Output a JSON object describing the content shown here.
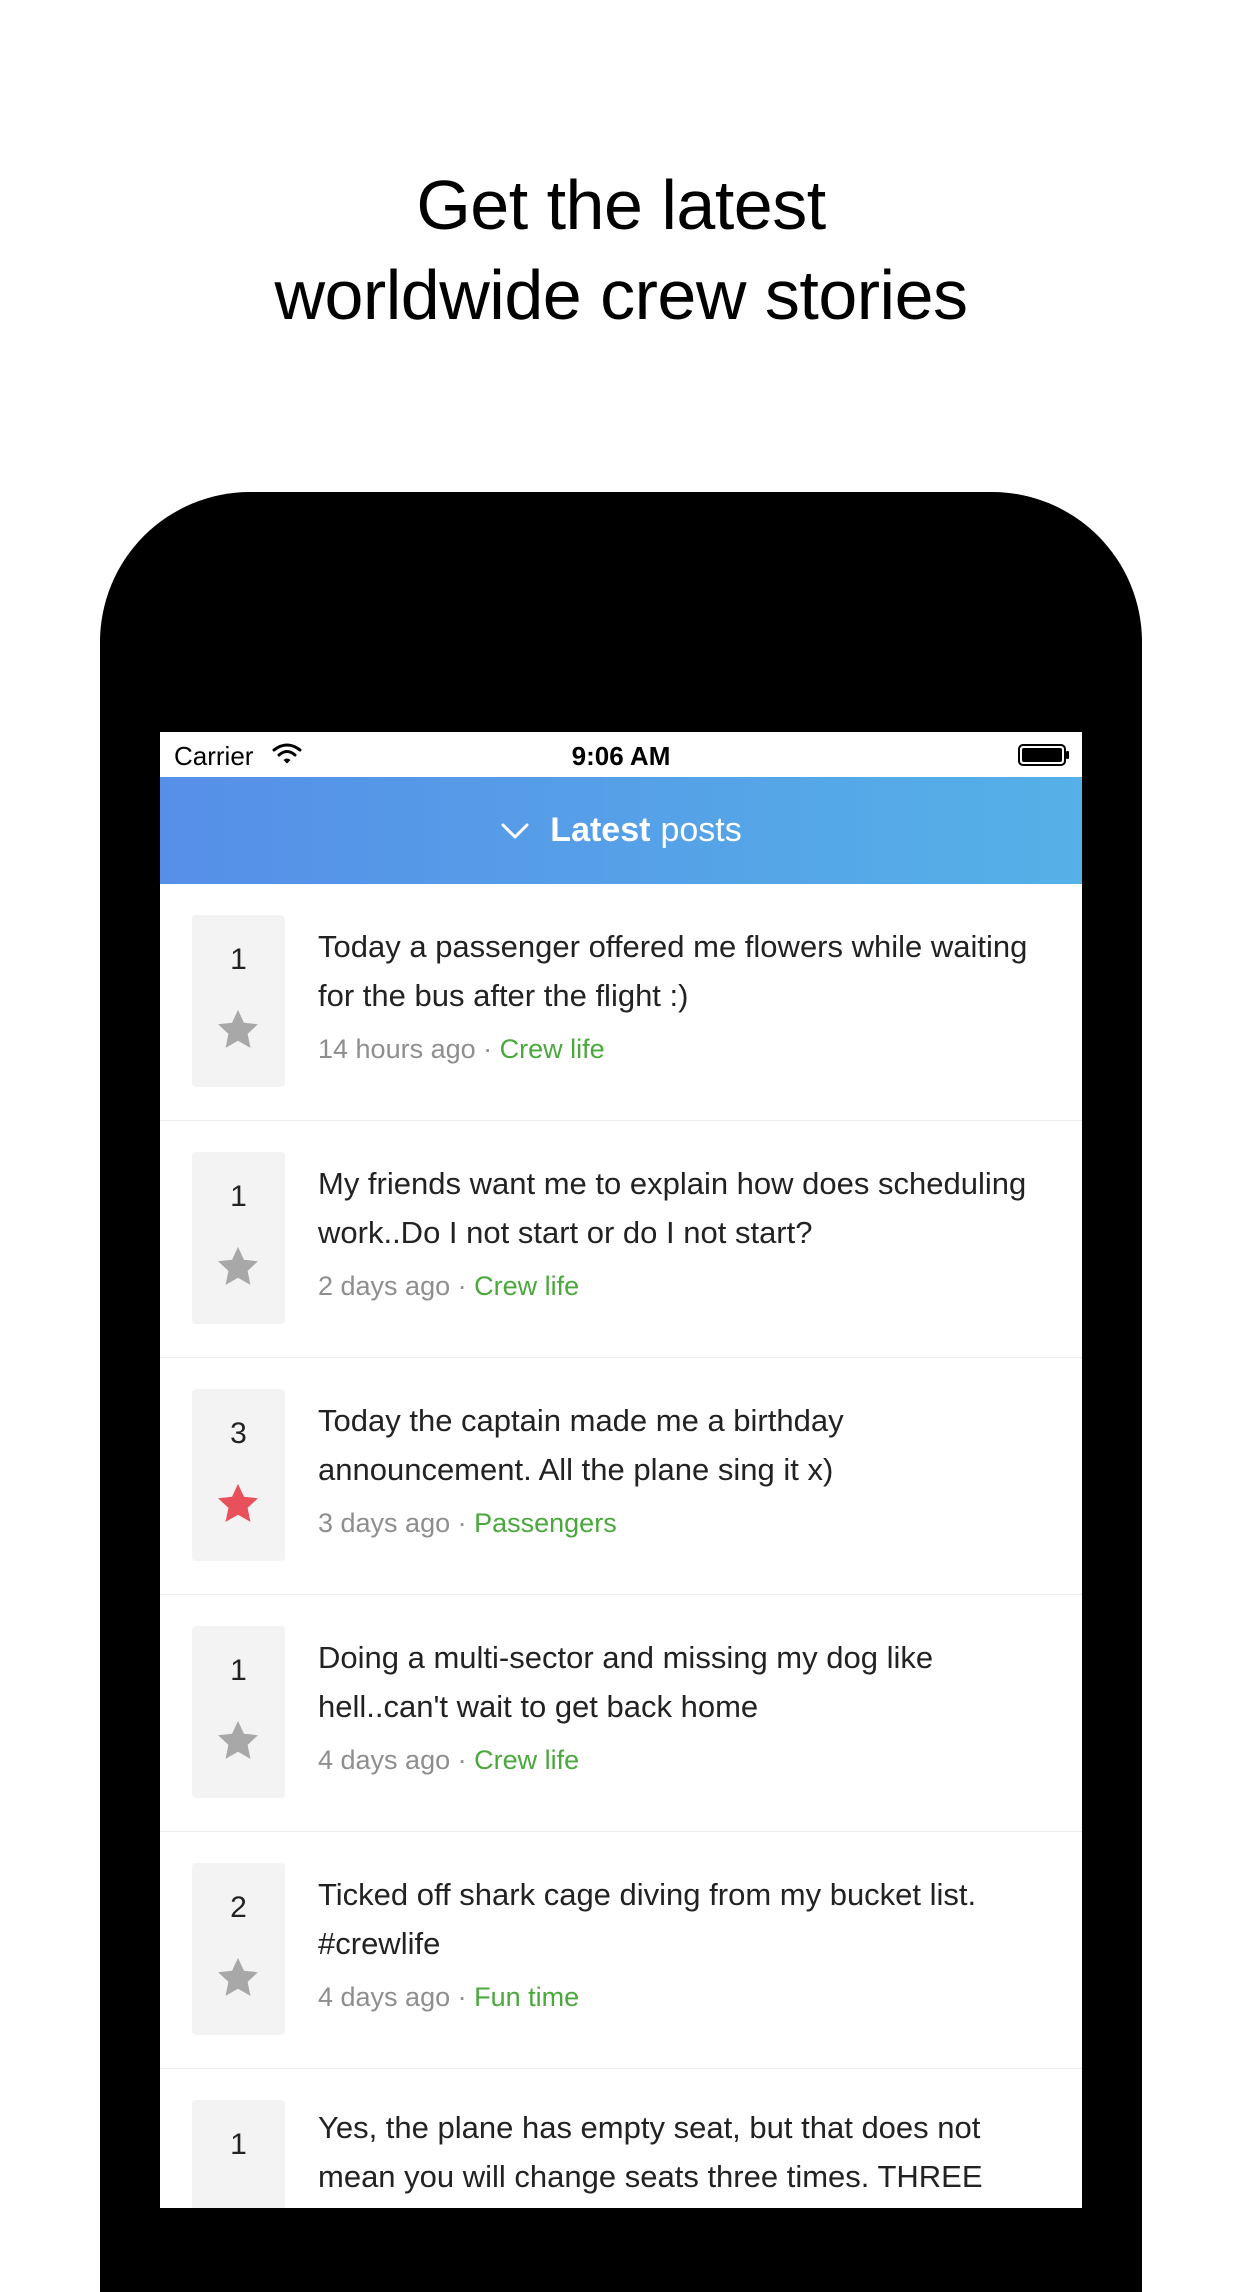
{
  "headline": {
    "line1": "Get the latest",
    "line2": "worldwide crew stories"
  },
  "status_bar": {
    "carrier": "Carrier",
    "time": "9:06 AM"
  },
  "nav": {
    "title_bold": "Latest",
    "title_rest": "posts"
  },
  "posts": [
    {
      "votes": "1",
      "starred": false,
      "text": "Today a passenger offered me flowers while waiting for the bus after the flight :)",
      "time": "14 hours ago",
      "category": "Crew life"
    },
    {
      "votes": "1",
      "starred": false,
      "text": "My friends want me to explain how does scheduling work..Do I not start or do I not start?",
      "time": "2 days ago",
      "category": "Crew life"
    },
    {
      "votes": "3",
      "starred": true,
      "text": "Today the captain made me a birthday announcement. All the plane sing it x)",
      "time": "3 days ago",
      "category": "Passengers"
    },
    {
      "votes": "1",
      "starred": false,
      "text": "Doing a multi-sector and missing my dog like hell..can't wait to get back home",
      "time": "4 days ago",
      "category": "Crew life"
    },
    {
      "votes": "2",
      "starred": false,
      "text": "Ticked off shark cage diving from my bucket list. #crewlife",
      "time": "4 days ago",
      "category": "Fun time"
    },
    {
      "votes": "1",
      "starred": false,
      "text": "Yes, the plane has empty seat, but that does not mean you will change seats three times. THREE TIMES!",
      "time": "",
      "category": ""
    }
  ],
  "meta_separator": " · ",
  "colors": {
    "accent_green": "#4aa83c",
    "star_active": "#e8505b",
    "star_inactive": "#a8a8a8",
    "nav_gradient_start": "#568fe8",
    "nav_gradient_end": "#55b1e7"
  }
}
